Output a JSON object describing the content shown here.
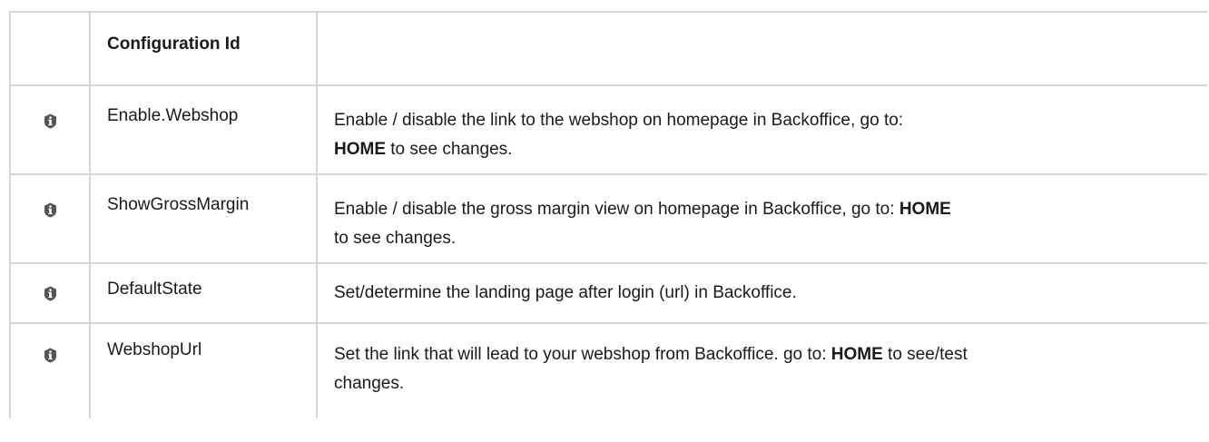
{
  "table": {
    "header": {
      "icon_col": "",
      "id_col": "Configuration Id",
      "desc_col": ""
    },
    "rows": [
      {
        "icon": "info-icon",
        "id": "Enable.Webshop",
        "desc_line1": "Enable / disable the link to the webshop on homepage in Backoffice,  go to:",
        "desc_bold": "HOME",
        "desc_tail": " to see changes."
      },
      {
        "icon": "info-icon",
        "id": "ShowGrossMargin",
        "desc_line1": "Enable / disable the gross margin view on homepage in Backoffice, go to: ",
        "desc_bold": "HOME",
        "desc_tail": "to see changes."
      },
      {
        "icon": "info-icon",
        "id": "DefaultState",
        "desc_line1": "Set/determine the landing page after login (url) in Backoffice."
      },
      {
        "icon": "info-icon",
        "id": "WebshopUrl",
        "desc_line1": "Set the link that will lead to your webshop from Backoffice. go to: ",
        "desc_bold": "HOME",
        "desc_tail": " to see/test changes."
      }
    ]
  },
  "colors": {
    "border": "#d6d6d6",
    "icon": "#555555",
    "text": "#1a1a1a"
  }
}
